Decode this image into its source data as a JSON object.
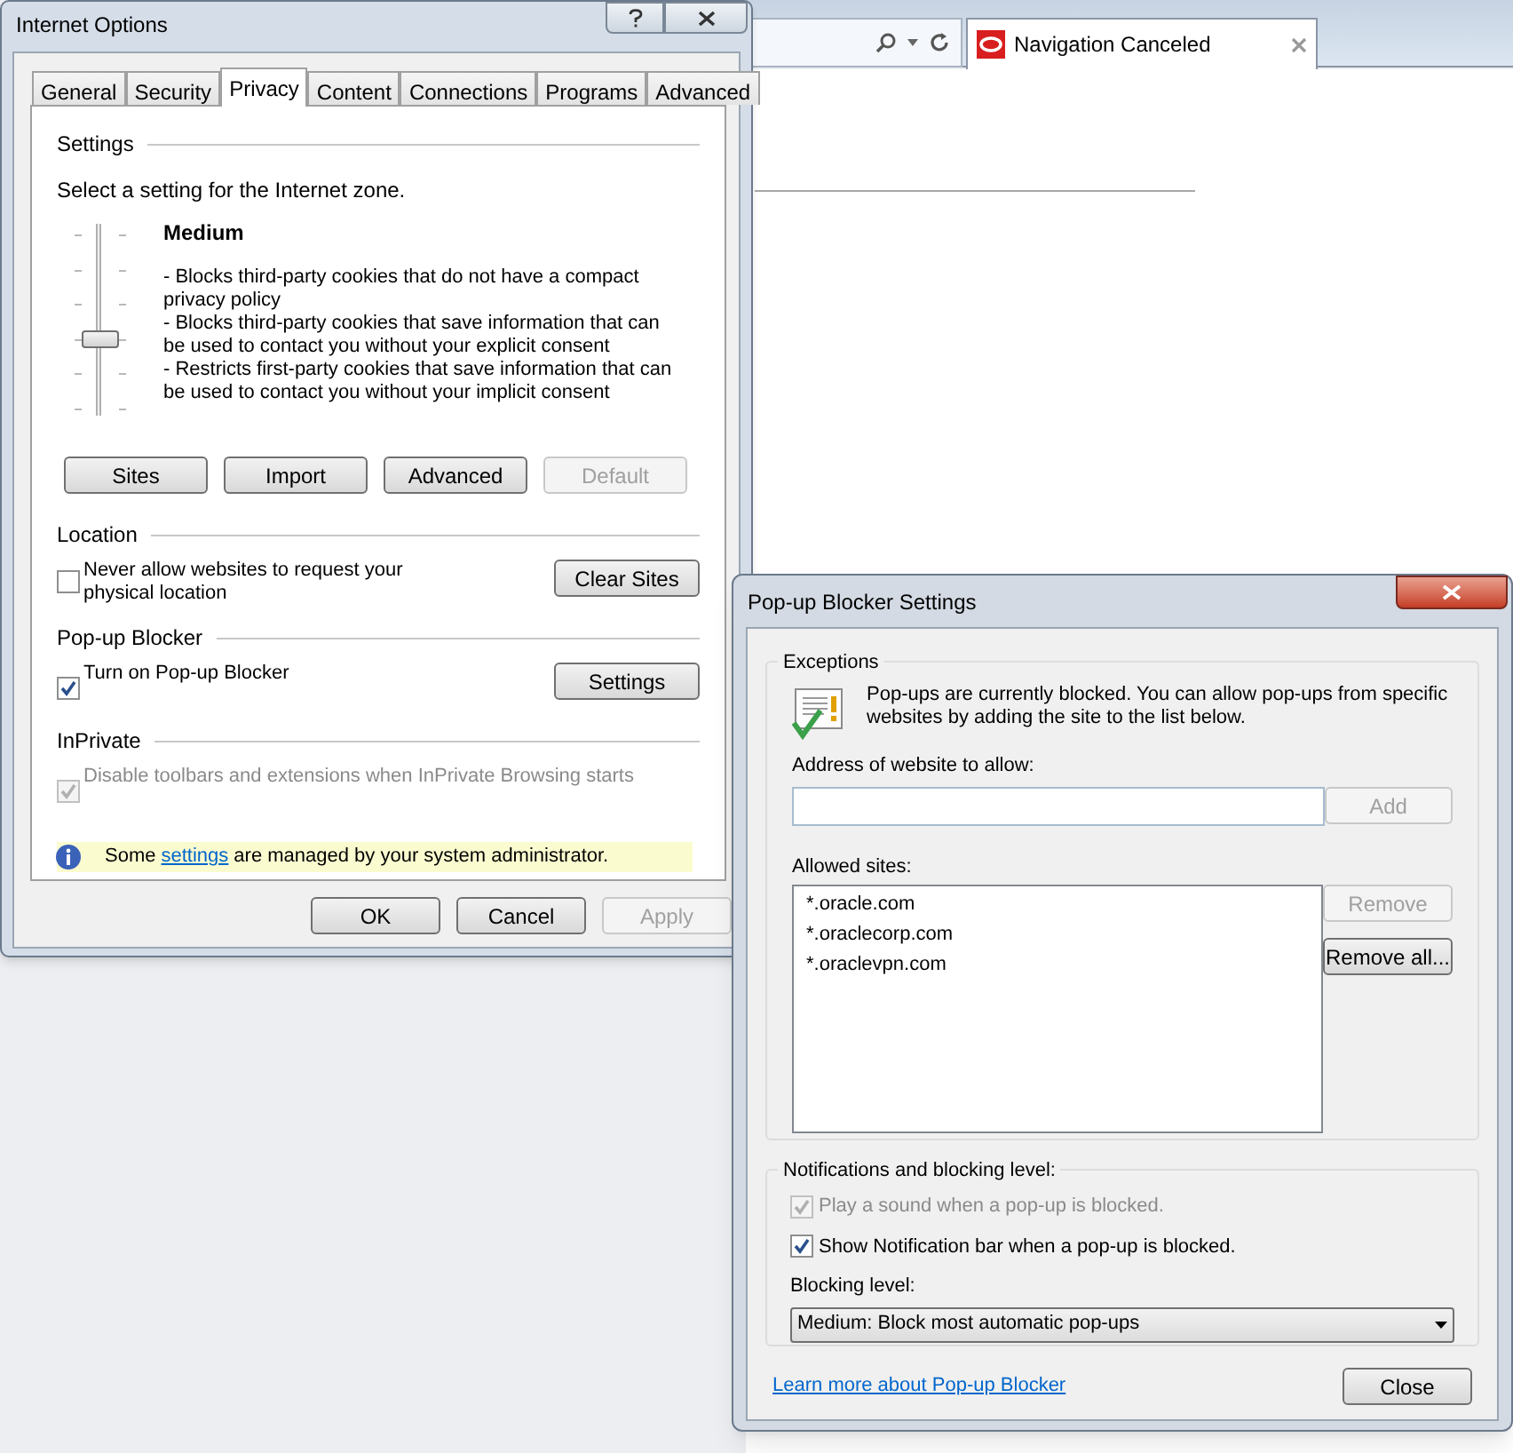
{
  "browser": {
    "tab": {
      "title": "Navigation Canceled"
    }
  },
  "internet_options": {
    "title": "Internet Options",
    "tabs": [
      {
        "label": "General",
        "selected": false
      },
      {
        "label": "Security",
        "selected": false
      },
      {
        "label": "Privacy",
        "selected": true
      },
      {
        "label": "Content",
        "selected": false
      },
      {
        "label": "Connections",
        "selected": false
      },
      {
        "label": "Programs",
        "selected": false
      },
      {
        "label": "Advanced",
        "selected": false
      }
    ],
    "settings": {
      "heading": "Settings",
      "prompt": "Select a setting for the Internet zone.",
      "slider": {
        "level": 0.4
      },
      "level_name": "Medium",
      "description": [
        "- Blocks third-party cookies that do not have a compact privacy policy",
        "- Blocks third-party cookies that save information that can be used to contact you without your explicit consent",
        "- Restricts first-party cookies that save information that can be used to contact you without your implicit consent"
      ],
      "buttons": [
        {
          "label": "Sites",
          "disabled": false
        },
        {
          "label": "Import",
          "disabled": false
        },
        {
          "label": "Advanced",
          "disabled": false
        },
        {
          "label": "Default",
          "disabled": true
        }
      ]
    },
    "sections": [
      {
        "heading": "Location",
        "checkbox": {
          "label": "Never allow websites to request your physical location",
          "checked": false,
          "disabled": false
        },
        "button": "Clear Sites"
      },
      {
        "heading": "Pop-up Blocker",
        "checkbox": {
          "label": "Turn on Pop-up Blocker",
          "checked": true,
          "disabled": false
        },
        "button": "Settings"
      },
      {
        "heading": "InPrivate",
        "checkbox": {
          "label": "Disable toolbars and extensions when InPrivate Browsing starts",
          "checked": true,
          "disabled": true
        }
      }
    ],
    "notice": {
      "before": "Some",
      "link": "settings",
      "after": "are managed by your system administrator."
    },
    "footer_buttons": [
      {
        "label": "OK",
        "disabled": false
      },
      {
        "label": "Cancel",
        "disabled": false
      },
      {
        "label": "Apply",
        "disabled": true
      }
    ]
  },
  "popup_settings": {
    "title": "Pop-up Blocker Settings",
    "exceptions": {
      "heading": "Exceptions",
      "info": "Pop-ups are currently blocked.  You can allow pop-ups from specific websites by adding the site to the list below.",
      "address_label": "Address of website to allow:",
      "add_button": {
        "label": "Add",
        "disabled": true
      },
      "allowed_label": "Allowed sites:",
      "sites": [
        "*.oracle.com",
        "*.oraclecorp.com",
        "*.oraclevpn.com"
      ],
      "remove_button": {
        "label": "Remove",
        "disabled": true
      },
      "remove_all_button": {
        "label": "Remove all...",
        "disabled": false
      }
    },
    "notifications": {
      "heading": "Notifications and blocking level:",
      "options": [
        {
          "label": "Play a sound when a pop-up is blocked.",
          "checked": true,
          "disabled": true
        },
        {
          "label": "Show Notification bar when a pop-up is blocked.",
          "checked": true,
          "disabled": false
        }
      ],
      "blocking_label": "Blocking level:",
      "blocking_value": "Medium: Block most automatic pop-ups"
    },
    "link": "Learn more about Pop-up Blocker",
    "close_button": "Close"
  }
}
